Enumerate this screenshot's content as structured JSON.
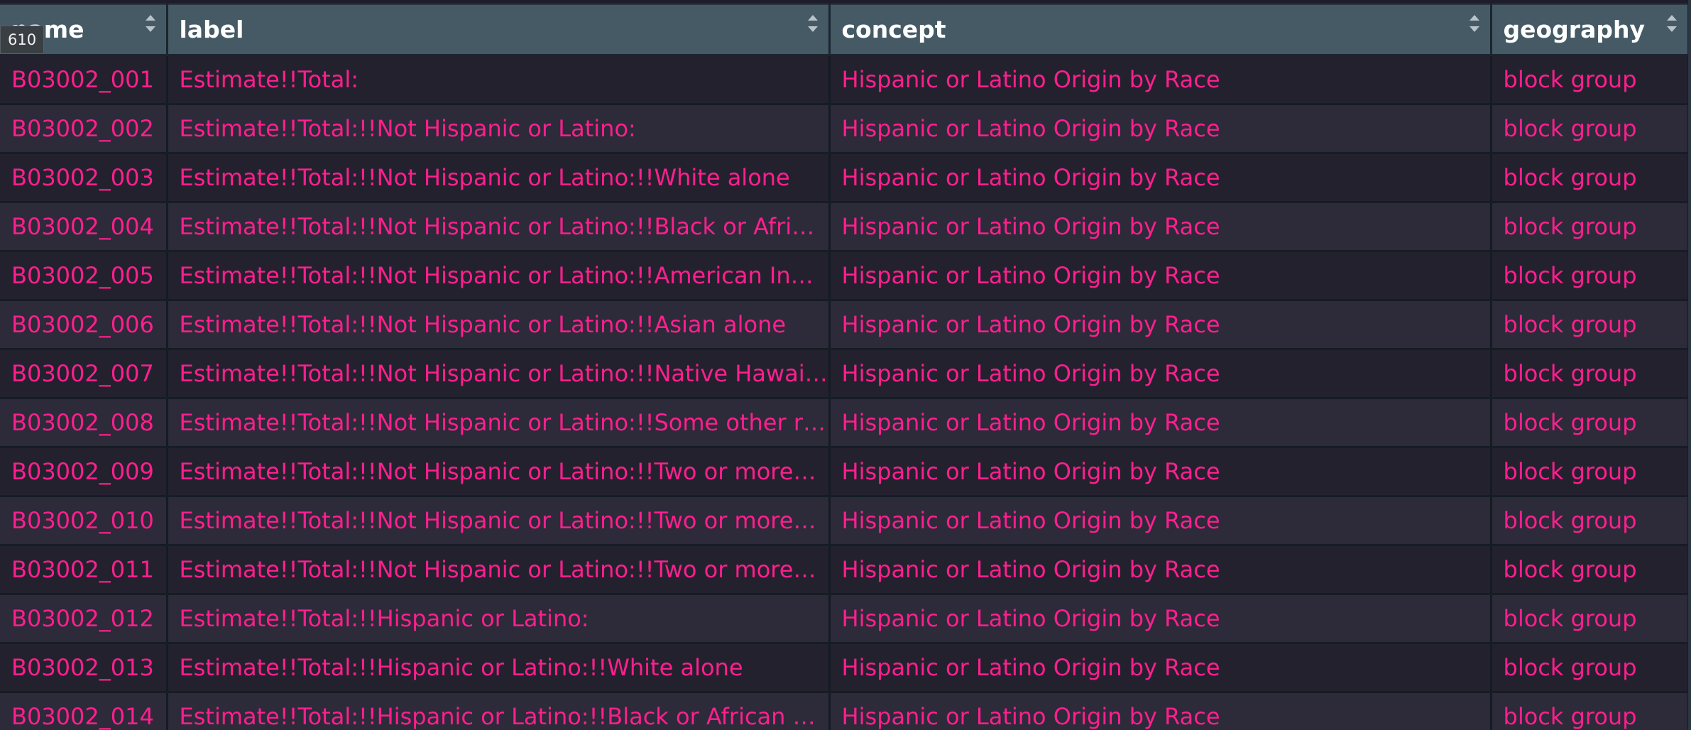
{
  "tooltip": "610",
  "columns": [
    {
      "key": "name",
      "label": "name"
    },
    {
      "key": "label",
      "label": "label"
    },
    {
      "key": "concept",
      "label": "concept"
    },
    {
      "key": "geography",
      "label": "geography"
    }
  ],
  "rows": [
    {
      "name": "B03002_001",
      "label": "Estimate!!Total:",
      "concept": "Hispanic or Latino Origin by Race",
      "geography": "block group"
    },
    {
      "name": "B03002_002",
      "label": "Estimate!!Total:!!Not Hispanic or Latino:",
      "concept": "Hispanic or Latino Origin by Race",
      "geography": "block group"
    },
    {
      "name": "B03002_003",
      "label": "Estimate!!Total:!!Not Hispanic or Latino:!!White alone",
      "concept": "Hispanic or Latino Origin by Race",
      "geography": "block group"
    },
    {
      "name": "B03002_004",
      "label": "Estimate!!Total:!!Not Hispanic or Latino:!!Black or Afri…",
      "concept": "Hispanic or Latino Origin by Race",
      "geography": "block group"
    },
    {
      "name": "B03002_005",
      "label": "Estimate!!Total:!!Not Hispanic or Latino:!!American In…",
      "concept": "Hispanic or Latino Origin by Race",
      "geography": "block group"
    },
    {
      "name": "B03002_006",
      "label": "Estimate!!Total:!!Not Hispanic or Latino:!!Asian alone",
      "concept": "Hispanic or Latino Origin by Race",
      "geography": "block group"
    },
    {
      "name": "B03002_007",
      "label": "Estimate!!Total:!!Not Hispanic or Latino:!!Native Hawai…",
      "concept": "Hispanic or Latino Origin by Race",
      "geography": "block group"
    },
    {
      "name": "B03002_008",
      "label": "Estimate!!Total:!!Not Hispanic or Latino:!!Some other r…",
      "concept": "Hispanic or Latino Origin by Race",
      "geography": "block group"
    },
    {
      "name": "B03002_009",
      "label": "Estimate!!Total:!!Not Hispanic or Latino:!!Two or more…",
      "concept": "Hispanic or Latino Origin by Race",
      "geography": "block group"
    },
    {
      "name": "B03002_010",
      "label": "Estimate!!Total:!!Not Hispanic or Latino:!!Two or more…",
      "concept": "Hispanic or Latino Origin by Race",
      "geography": "block group"
    },
    {
      "name": "B03002_011",
      "label": "Estimate!!Total:!!Not Hispanic or Latino:!!Two or more…",
      "concept": "Hispanic or Latino Origin by Race",
      "geography": "block group"
    },
    {
      "name": "B03002_012",
      "label": "Estimate!!Total:!!Hispanic or Latino:",
      "concept": "Hispanic or Latino Origin by Race",
      "geography": "block group"
    },
    {
      "name": "B03002_013",
      "label": "Estimate!!Total:!!Hispanic or Latino:!!White alone",
      "concept": "Hispanic or Latino Origin by Race",
      "geography": "block group"
    },
    {
      "name": "B03002_014",
      "label": "Estimate!!Total:!!Hispanic or Latino:!!Black or African …",
      "concept": "Hispanic or Latino Origin by Race",
      "geography": "block group"
    }
  ],
  "colors": {
    "header_bg": "#455a64",
    "cell_text": "#ff1f8e",
    "row_odd": "#24212f",
    "row_even": "#2d2a3a"
  },
  "icons": {
    "sort": "sort-arrows-icon"
  }
}
